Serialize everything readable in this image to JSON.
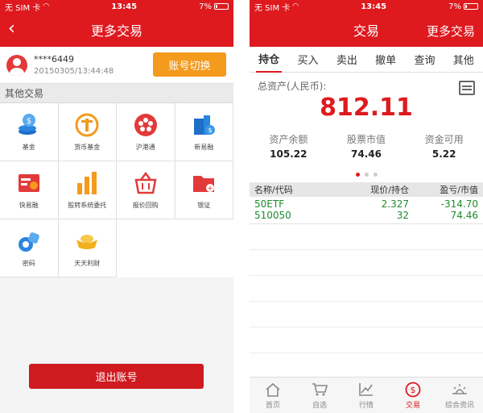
{
  "status": {
    "carrier": "无 SIM 卡",
    "time": "13:45",
    "battery": "7%"
  },
  "left": {
    "nav_title": "更多交易",
    "account_number": "****6449",
    "account_time": "20150305/13:44:48",
    "switch_label": "账号切换",
    "section_title": "其他交易",
    "grid": [
      {
        "label": "基金",
        "icon": "fund-icon"
      },
      {
        "label": "货币基金",
        "icon": "money-fund-icon"
      },
      {
        "label": "沪港通",
        "icon": "hk-connect-icon"
      },
      {
        "label": "新易融",
        "icon": "finance-icon"
      },
      {
        "label": "快易融",
        "icon": "quick-finance-icon"
      },
      {
        "label": "股转系统委托",
        "icon": "stock-transfer-icon"
      },
      {
        "label": "报价回购",
        "icon": "repo-basket-icon"
      },
      {
        "label": "银证",
        "icon": "bank-folder-icon"
      },
      {
        "label": "密码",
        "icon": "password-key-icon"
      },
      {
        "label": "天天利财",
        "icon": "gold-ingot-icon"
      }
    ],
    "logout_label": "退出账号"
  },
  "right": {
    "nav_title": "交易",
    "nav_right": "更多交易",
    "tabs": [
      "持仓",
      "买入",
      "卖出",
      "撤单",
      "查询",
      "其他"
    ],
    "assets_caption": "总资产(人民币):",
    "total": "812.11",
    "stats": [
      {
        "label": "资产余额",
        "value": "105.22"
      },
      {
        "label": "股票市值",
        "value": "74.46"
      },
      {
        "label": "资金可用",
        "value": "5.22"
      }
    ],
    "holdings_header": [
      "名称/代码",
      "现价/持仓",
      "盈亏/市值"
    ],
    "holdings": [
      {
        "name": "50ETF",
        "code": "510050",
        "price": "2.327",
        "qty": "32",
        "pnl": "-314.70",
        "mv": "74.46"
      }
    ],
    "bottom_tabs": [
      {
        "label": "首页",
        "icon": "home-icon"
      },
      {
        "label": "自选",
        "icon": "cart-icon"
      },
      {
        "label": "行情",
        "icon": "chart-icon"
      },
      {
        "label": "交易",
        "icon": "trade-icon"
      },
      {
        "label": "综合资讯",
        "icon": "news-icon"
      }
    ]
  },
  "colors": {
    "brand_red": "#de1a1f",
    "switch_orange": "#f49a1d",
    "gain_green": "#1e8a2e"
  }
}
